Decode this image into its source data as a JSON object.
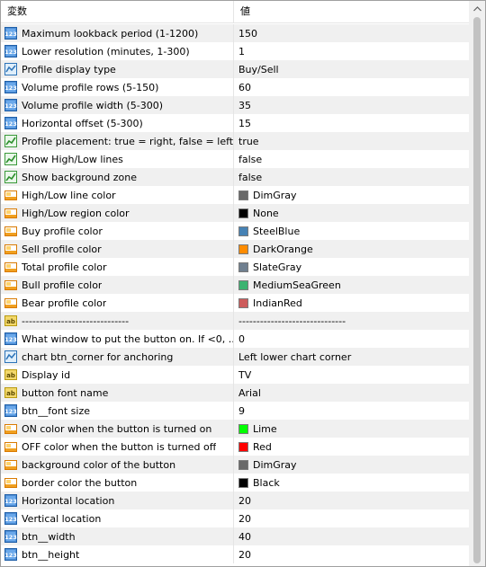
{
  "header": {
    "name": "変数",
    "value": "値"
  },
  "rows": [
    {
      "icon": "int",
      "label": "Maximum lookback period (1-1200)",
      "value": "150"
    },
    {
      "icon": "int",
      "label": "Lower resolution (minutes, 1-300)",
      "value": "1"
    },
    {
      "icon": "enum",
      "label": "Profile display type",
      "value": "Buy/Sell"
    },
    {
      "icon": "int",
      "label": "Volume profile rows (5-150)",
      "value": "60"
    },
    {
      "icon": "int",
      "label": "Volume profile width (5-300)",
      "value": "35"
    },
    {
      "icon": "int",
      "label": "Horizontal offset (5-300)",
      "value": "15"
    },
    {
      "icon": "bool",
      "label": "Profile placement: true = right, false = left",
      "value": "true"
    },
    {
      "icon": "bool",
      "label": "Show High/Low lines",
      "value": "false"
    },
    {
      "icon": "bool",
      "label": "Show background zone",
      "value": "false"
    },
    {
      "icon": "color",
      "label": "High/Low line color",
      "value": "DimGray",
      "swatch": "#696969"
    },
    {
      "icon": "color",
      "label": "High/Low region color",
      "value": "None",
      "swatch": "#000000"
    },
    {
      "icon": "color",
      "label": "Buy profile color",
      "value": "SteelBlue",
      "swatch": "#4682b4"
    },
    {
      "icon": "color",
      "label": "Sell profile color",
      "value": "DarkOrange",
      "swatch": "#ff8c00"
    },
    {
      "icon": "color",
      "label": "Total profile color",
      "value": "SlateGray",
      "swatch": "#708090"
    },
    {
      "icon": "color",
      "label": "Bull profile color",
      "value": "MediumSeaGreen",
      "swatch": "#3cb371"
    },
    {
      "icon": "color",
      "label": "Bear profile color",
      "value": "IndianRed",
      "swatch": "#cd5c5c"
    },
    {
      "icon": "string",
      "label": "------------------------------",
      "value": "------------------------------"
    },
    {
      "icon": "int",
      "label": "What window to put the button on.  If <0, ...",
      "value": "0"
    },
    {
      "icon": "enum",
      "label": "chart btn_corner for anchoring",
      "value": "Left lower chart corner"
    },
    {
      "icon": "string",
      "label": "Display id",
      "value": "TV"
    },
    {
      "icon": "string",
      "label": "button font name",
      "value": "Arial"
    },
    {
      "icon": "int",
      "label": "btn__font size",
      "value": "9"
    },
    {
      "icon": "color",
      "label": "ON color when the button is turned on",
      "value": "Lime",
      "swatch": "#00ff00"
    },
    {
      "icon": "color",
      "label": "OFF color when the button is turned off",
      "value": "Red",
      "swatch": "#ff0000"
    },
    {
      "icon": "color",
      "label": "background color of the button",
      "value": "DimGray",
      "swatch": "#696969"
    },
    {
      "icon": "color",
      "label": "border color the button",
      "value": "Black",
      "swatch": "#000000"
    },
    {
      "icon": "int",
      "label": "Horizontal location",
      "value": "20"
    },
    {
      "icon": "int",
      "label": "Vertical location",
      "value": "20"
    },
    {
      "icon": "int",
      "label": "btn__width",
      "value": "40"
    },
    {
      "icon": "int",
      "label": "btn__height",
      "value": "20"
    }
  ],
  "scrollbar": {
    "up_icon": "scroll-up-arrow-icon"
  }
}
